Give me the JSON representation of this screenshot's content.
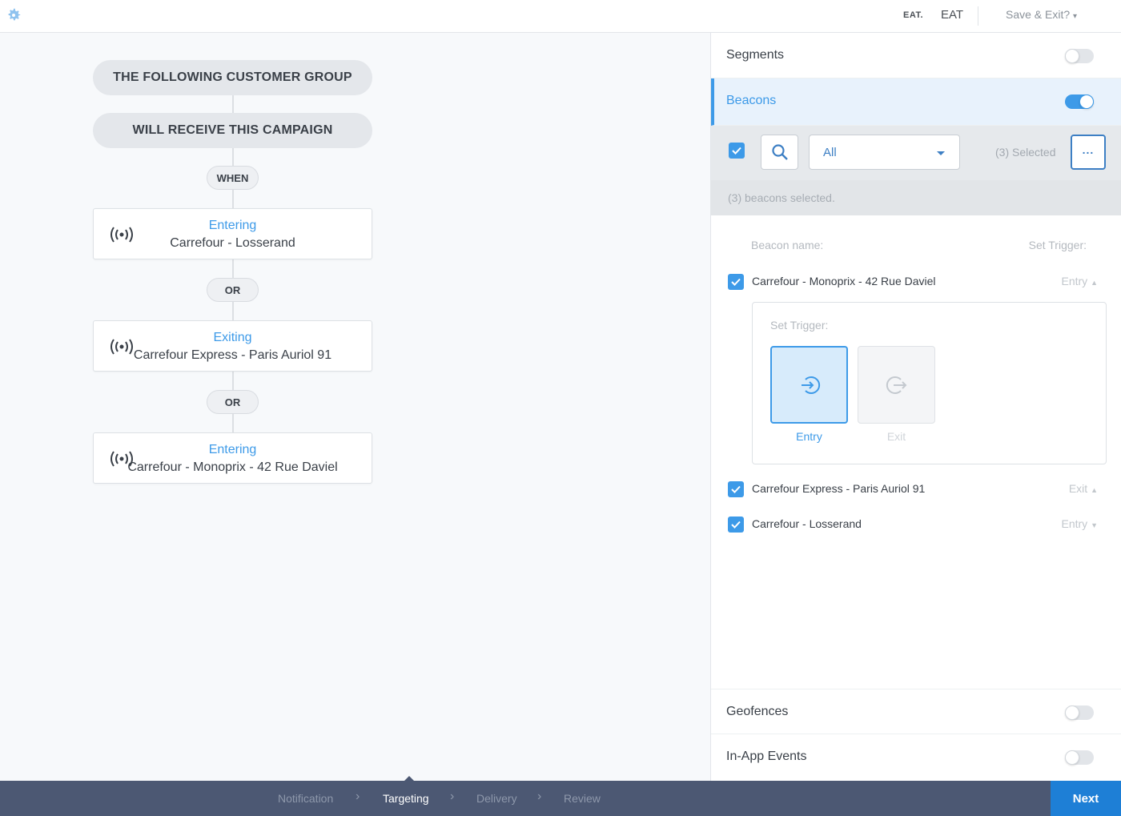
{
  "header": {
    "brand_small": "EAT.",
    "brand_name": "EAT",
    "save_exit": "Save & Exit?"
  },
  "flow": {
    "group_label": "THE FOLLOWING CUSTOMER GROUP",
    "campaign_label": "WILL RECEIVE THIS CAMPAIGN",
    "when_label": "WHEN",
    "or_label": "OR",
    "rules": [
      {
        "trigger": "Entering",
        "beacon": "Carrefour - Losserand"
      },
      {
        "trigger": "Exiting",
        "beacon": "Carrefour Express - Paris Auriol 91"
      },
      {
        "trigger": "Entering",
        "beacon": "Carrefour - Monoprix - 42 Rue Daviel"
      }
    ]
  },
  "panel": {
    "segments": {
      "label": "Segments",
      "enabled": false
    },
    "beacons": {
      "label": "Beacons",
      "enabled": true
    },
    "filter": {
      "select_value": "All",
      "selected_count": "(3) Selected",
      "more_label": "..."
    },
    "info": "(3) beacons selected.",
    "columns": {
      "name": "Beacon name:",
      "trigger": "Set Trigger:"
    },
    "beacon_list": [
      {
        "name": "Carrefour - Monoprix - 42 Rue Daviel",
        "trigger": "Entry",
        "checked": true
      },
      {
        "name": "Carrefour Express - Paris Auriol 91",
        "trigger": "Exit",
        "checked": true
      },
      {
        "name": "Carrefour - Losserand",
        "trigger": "Entry",
        "checked": true
      }
    ],
    "trigger_box": {
      "label": "Set Trigger:",
      "entry": "Entry",
      "exit": "Exit"
    },
    "geofences": {
      "label": "Geofences",
      "enabled": false
    },
    "inapp": {
      "label": "In-App Events",
      "enabled": false
    }
  },
  "footer": {
    "steps": [
      "Notification",
      "Targeting",
      "Delivery",
      "Review"
    ],
    "current_step": "Targeting",
    "next_label": "Next"
  },
  "colors": {
    "accent": "#3d9ae8",
    "footer": "#4c5873",
    "next": "#1e7fd6"
  }
}
